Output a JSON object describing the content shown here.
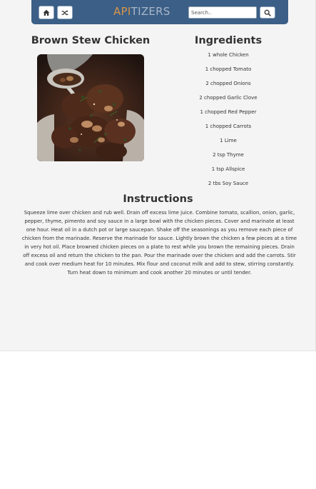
{
  "navbar": {
    "home_icon": "home-icon",
    "random_icon": "shuffle-icon",
    "brand_part1": "API",
    "brand_part2": "TIZERS",
    "search_placeholder": "Search..",
    "search_icon": "search-icon"
  },
  "colors": {
    "navbar": "#3b5f86",
    "brand_part1": "#d9944a",
    "brand_part2": "#a8b6c8",
    "page_background": "#f4f4f4"
  },
  "recipe": {
    "title": "Brown Stew Chicken",
    "image": "brown-stew-chicken-photo"
  },
  "ingredients": {
    "heading": "Ingredients",
    "items": [
      "1 whole Chicken",
      "1 chopped Tomato",
      "2 chopped Onions",
      "2 chopped Garlic Clove",
      "1 chopped Red Pepper",
      "1 chopped Carrots",
      "1 Lime",
      "2 tsp Thyme",
      "1 tsp Allspice",
      "2 tbs Soy Sauce"
    ]
  },
  "instructions": {
    "heading": "Instructions",
    "text": "Squeeze lime over chicken and rub well. Drain off excess lime juice. Combine tomato, scallion, onion, garlic, pepper, thyme, pimento and soy sauce in a large bowl with the chicken pieces. Cover and marinate at least one hour. Heat oil in a dutch pot or large saucepan. Shake off the seasonings as you remove each piece of chicken from the marinade. Reserve the marinade for sauce. Lightly brown the chicken a few pieces at a time in very hot oil. Place browned chicken pieces on a plate to rest while you brown the remaining pieces. Drain off excess oil and return the chicken to the pan. Pour the marinade over the chicken and add the carrots. Stir and cook over medium heat for 10 minutes. Mix flour and coconut milk and add to stew, stirring constantly. Turn heat down to minimum and cook another 20 minutes or until tender."
  }
}
